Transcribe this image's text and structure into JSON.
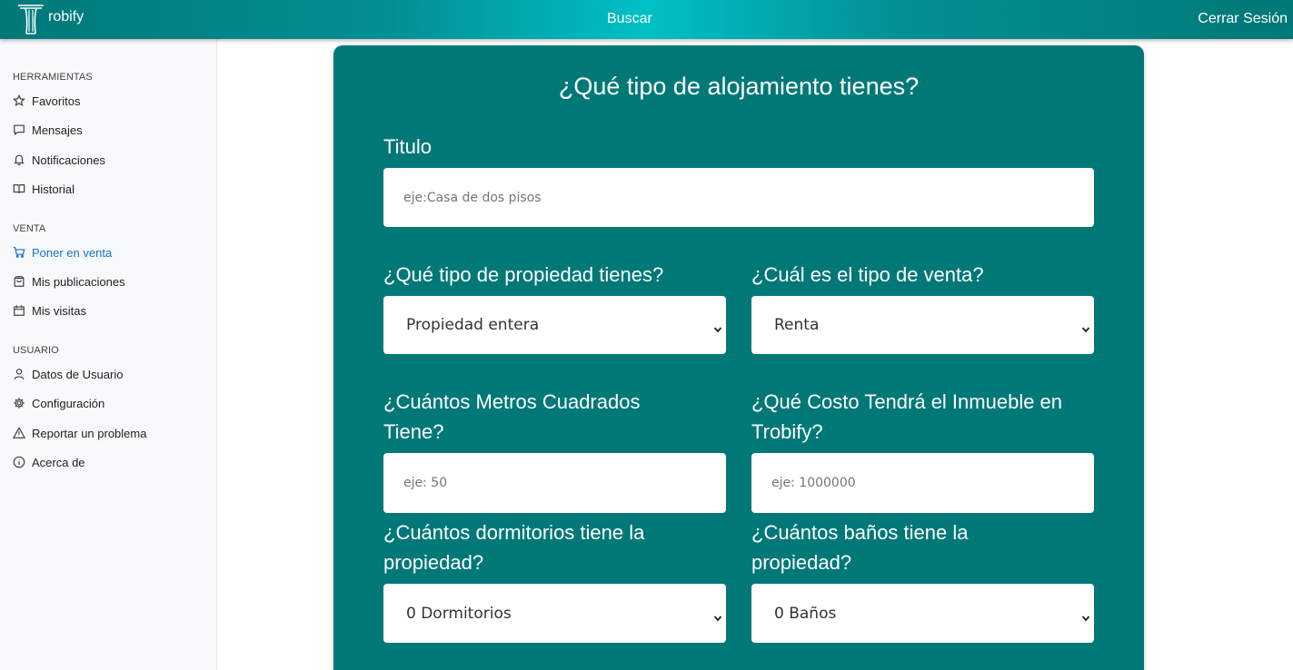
{
  "header": {
    "brand": "robify",
    "search_label": "Buscar",
    "logout_label": "Cerrar Sesión"
  },
  "sidebar": {
    "sections": [
      {
        "title": "HERRAMIENTAS",
        "items": [
          {
            "label": "Favoritos",
            "icon": "star-icon"
          },
          {
            "label": "Mensajes",
            "icon": "chat-icon"
          },
          {
            "label": "Notificaciones",
            "icon": "bell-icon"
          },
          {
            "label": "Historial",
            "icon": "book-icon"
          }
        ]
      },
      {
        "title": "VENTA",
        "items": [
          {
            "label": "Poner en venta",
            "icon": "cart-icon",
            "active": true
          },
          {
            "label": "Mis publicaciones",
            "icon": "bag-icon"
          },
          {
            "label": "Mis visitas",
            "icon": "calendar-icon"
          }
        ]
      },
      {
        "title": "USUARIO",
        "items": [
          {
            "label": "Datos de Usuario",
            "icon": "user-icon"
          },
          {
            "label": "Configuración",
            "icon": "gear-icon"
          },
          {
            "label": "Reportar un problema",
            "icon": "warning-icon"
          },
          {
            "label": "Acerca de",
            "icon": "info-icon"
          }
        ]
      }
    ],
    "active_color": "#1673c9"
  },
  "form": {
    "title": "¿Qué tipo de alojamiento tienes?",
    "titulo_label": "Titulo",
    "titulo_placeholder": "eje:Casa de dos pisos",
    "property_type_label": "¿Qué tipo de propiedad tienes?",
    "property_type_value": "Propiedad entera",
    "sale_type_label": "¿Cuál es el tipo de venta?",
    "sale_type_value": "Renta",
    "area_label_line1": "¿Cuántos Metros Cuadrados",
    "area_label_line2": "Tiene?",
    "area_placeholder": "eje: 50",
    "cost_label_line1": "¿Qué Costo Tendrá el Inmueble en",
    "cost_label_line2": "Trobify?",
    "cost_placeholder": "eje: 1000000",
    "bedrooms_label_line1": "¿Cuántos dormitorios tiene la",
    "bedrooms_label_line2": "propiedad?",
    "bedrooms_value": "0 Dormitorios",
    "bathrooms_label_line1": "¿Cuántos baños tiene la",
    "bathrooms_label_line2": "propiedad?",
    "bathrooms_value": "0 Baños"
  },
  "colors": {
    "card_bg": "#017878",
    "header_gradient_center": "#00c0c6",
    "header_gradient_edge": "#007878"
  }
}
